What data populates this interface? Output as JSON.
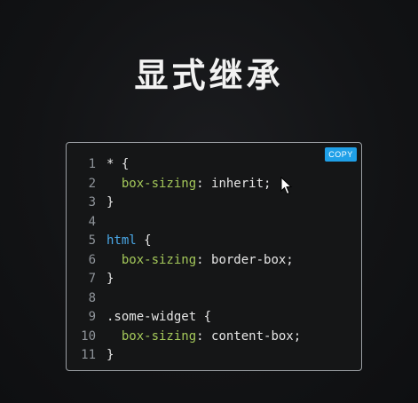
{
  "title": "显式继承",
  "copy_label": "COPY",
  "code_lines": [
    {
      "n": "1",
      "tokens": [
        {
          "t": "* {",
          "c": "plain"
        }
      ]
    },
    {
      "n": "2",
      "tokens": [
        {
          "t": "  ",
          "c": "plain"
        },
        {
          "t": "box-sizing",
          "c": "prop"
        },
        {
          "t": ": inherit;",
          "c": "plain"
        }
      ]
    },
    {
      "n": "3",
      "tokens": [
        {
          "t": "}",
          "c": "plain"
        }
      ]
    },
    {
      "n": "4",
      "tokens": []
    },
    {
      "n": "5",
      "tokens": [
        {
          "t": "html",
          "c": "sel"
        },
        {
          "t": " {",
          "c": "plain"
        }
      ]
    },
    {
      "n": "6",
      "tokens": [
        {
          "t": "  ",
          "c": "plain"
        },
        {
          "t": "box-sizing",
          "c": "prop"
        },
        {
          "t": ": border-box;",
          "c": "plain"
        }
      ]
    },
    {
      "n": "7",
      "tokens": [
        {
          "t": "}",
          "c": "plain"
        }
      ]
    },
    {
      "n": "8",
      "tokens": []
    },
    {
      "n": "9",
      "tokens": [
        {
          "t": ".some-widget {",
          "c": "plain"
        }
      ]
    },
    {
      "n": "10",
      "tokens": [
        {
          "t": "  ",
          "c": "plain"
        },
        {
          "t": "box-sizing",
          "c": "prop"
        },
        {
          "t": ": content-box;",
          "c": "plain"
        }
      ]
    },
    {
      "n": "11",
      "tokens": [
        {
          "t": "}",
          "c": "plain"
        }
      ]
    }
  ],
  "colors": {
    "background": "#111214",
    "property": "#a4c85a",
    "selector": "#4aa8e8",
    "copy_button": "#1fa0e8"
  },
  "icons": {
    "cursor": "mouse-pointer-icon"
  }
}
